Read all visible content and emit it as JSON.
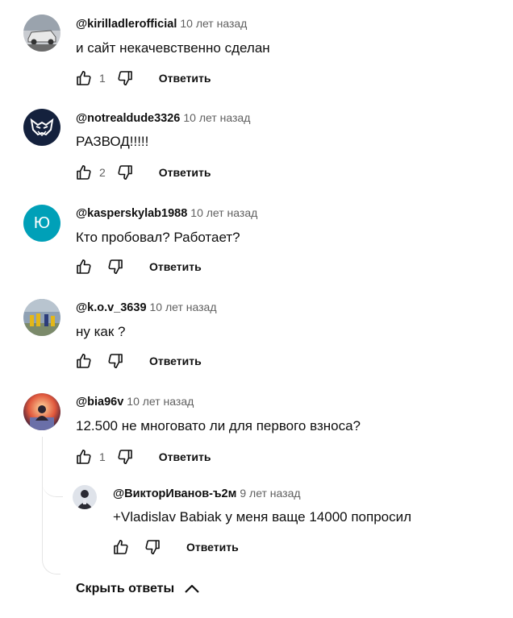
{
  "comments": [
    {
      "author": "@kirilladlerofficial",
      "time": "10 лет назад",
      "text": "и сайт некачевственно сделан",
      "likes": "1",
      "reply_label": "Ответить"
    },
    {
      "author": "@notrealdude3326",
      "time": "10 лет назад",
      "text": "РАЗВОД!!!!!",
      "likes": "2",
      "reply_label": "Ответить"
    },
    {
      "author": "@kasperskylab1988",
      "time": "10 лет назад",
      "text": "Кто пробовал? Работает?",
      "likes": "",
      "reply_label": "Ответить",
      "avatar_letter": "Ю",
      "avatar_color": "#00a0b8"
    },
    {
      "author": "@k.o.v_3639",
      "time": "10 лет назад",
      "text": "ну как ?",
      "likes": "",
      "reply_label": "Ответить"
    },
    {
      "author": "@bia96v",
      "time": "10 лет назад",
      "text": "12.500 не многовато ли для первого взноса?",
      "likes": "1",
      "reply_label": "Ответить"
    }
  ],
  "reply": {
    "author": "@ВикторИванов-ъ2м",
    "time": "9 лет назад",
    "text": "+Vladislav Babiak у меня ваще 14000 попросил",
    "reply_label": "Ответить"
  },
  "hide_replies_label": "Скрыть ответы",
  "icons": {
    "like": "thumb-up-icon",
    "dislike": "thumb-down-icon",
    "collapse": "chevron-up-icon"
  },
  "colors": {
    "text": "#0f0f0f",
    "secondary": "#606060",
    "thread_line": "#e5e5e5"
  }
}
